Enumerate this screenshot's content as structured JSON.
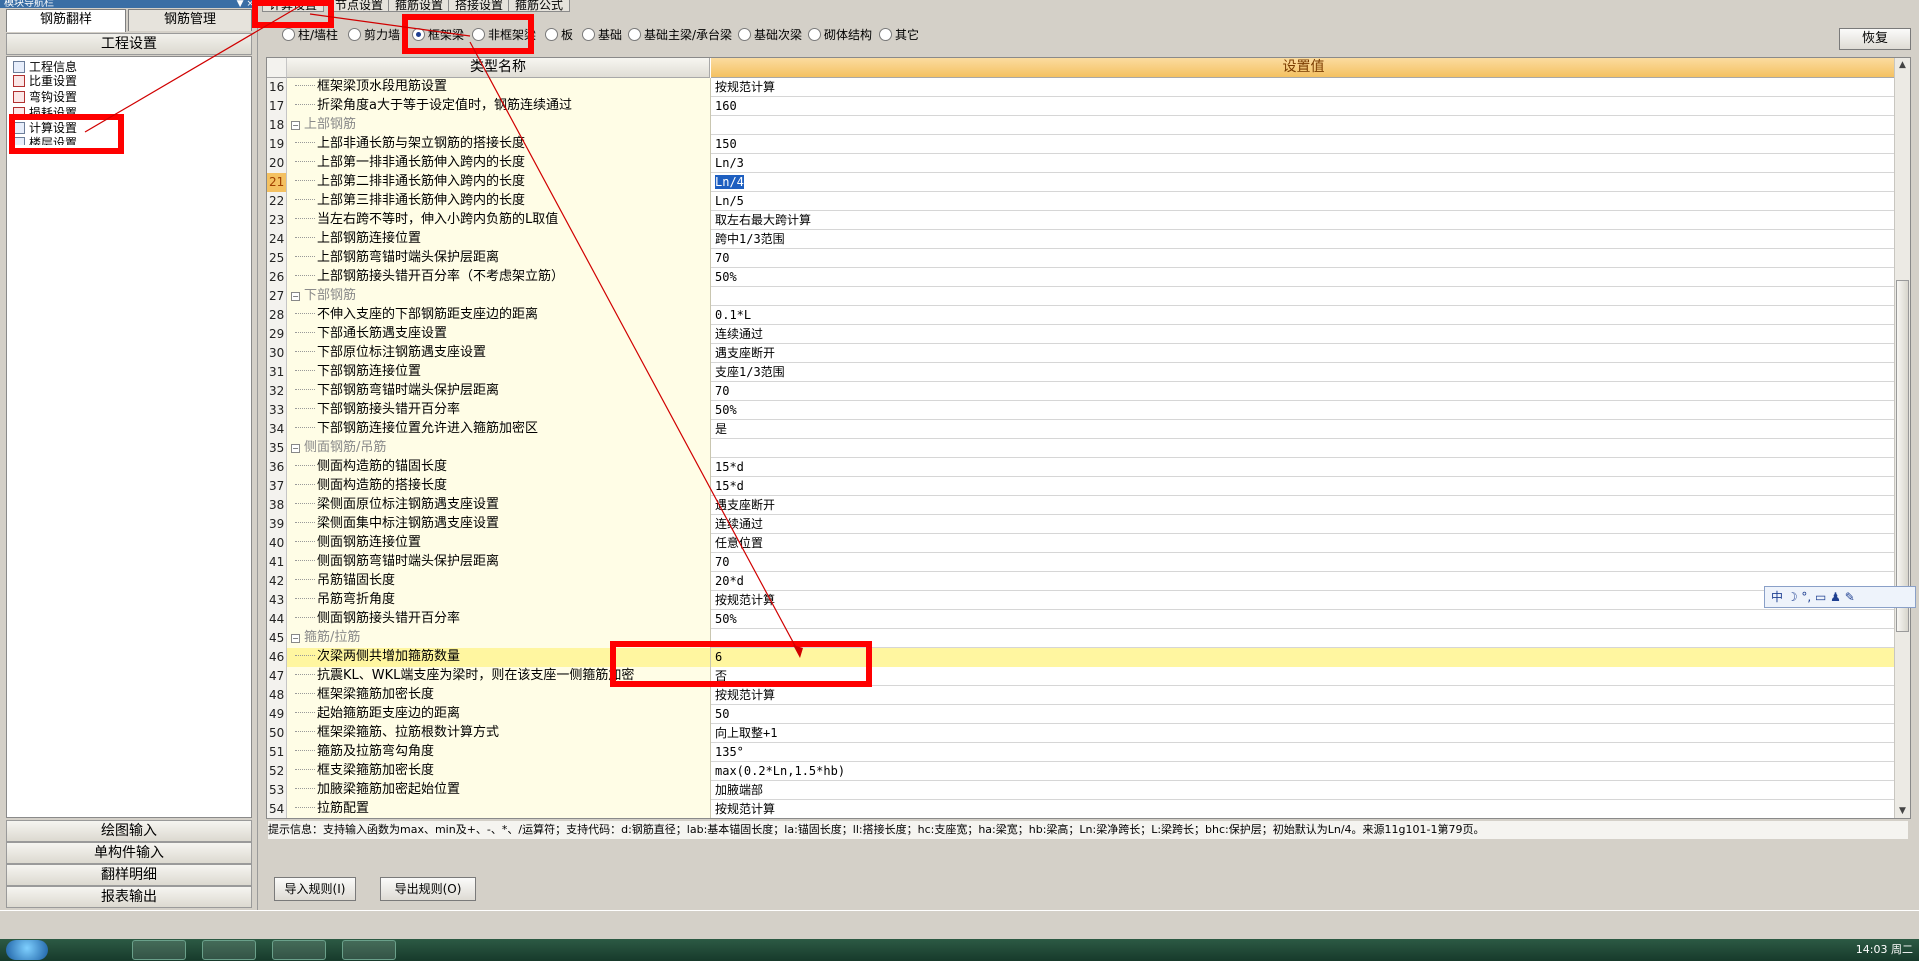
{
  "nav": {
    "caption": "模块导航栏",
    "ctrls": "▼ ×"
  },
  "left_tabs": [
    "钢筋翻样",
    "钢筋管理"
  ],
  "project_header": "工程设置",
  "tree": [
    "工程信息",
    "比重设置",
    "弯钩设置",
    "损耗设置",
    "计算设置",
    "楼层设置"
  ],
  "left_bottom": [
    "绘图输入",
    "单构件输入",
    "翻样明细",
    "报表输出"
  ],
  "top_tabs": [
    "计算设置",
    "节点设置",
    "箍筋设置",
    "搭接设置",
    "箍筋公式"
  ],
  "radios": [
    {
      "label": "柱/墙柱",
      "on": false
    },
    {
      "label": "剪力墙",
      "on": false
    },
    {
      "label": "框架梁",
      "on": true
    },
    {
      "label": "非框架梁",
      "on": false
    },
    {
      "label": "板",
      "on": false
    },
    {
      "label": "基础",
      "on": false
    },
    {
      "label": "基础主梁/承台梁",
      "on": false
    },
    {
      "label": "基础次梁",
      "on": false
    },
    {
      "label": "砌体结构",
      "on": false
    },
    {
      "label": "其它",
      "on": false
    }
  ],
  "restore_label": "恢复",
  "grid": {
    "col_name": "类型名称",
    "col_value": "设置值"
  },
  "rows": [
    {
      "n": "16",
      "name": "框架梁顶水段甩筋设置",
      "val": "按规范计算"
    },
    {
      "n": "17",
      "name": "折梁角度a大于等于设定值时，钢筋连续通过",
      "val": "160"
    },
    {
      "n": "18",
      "name": "上部钢筋",
      "val": "",
      "group": true
    },
    {
      "n": "19",
      "name": "上部非通长筋与架立钢筋的搭接长度",
      "val": "150"
    },
    {
      "n": "20",
      "name": "上部第一排非通长筋伸入跨内的长度",
      "val": "Ln/3"
    },
    {
      "n": "21",
      "name": "上部第二排非通长筋伸入跨内的长度",
      "val": "Ln/4",
      "sel": true
    },
    {
      "n": "22",
      "name": "上部第三排非通长筋伸入跨内的长度",
      "val": "Ln/5"
    },
    {
      "n": "23",
      "name": "当左右跨不等时，伸入小跨内负筋的L取值",
      "val": "取左右最大跨计算"
    },
    {
      "n": "24",
      "name": "上部钢筋连接位置",
      "val": "跨中1/3范围"
    },
    {
      "n": "25",
      "name": "上部钢筋弯锚时端头保护层距离",
      "val": "70"
    },
    {
      "n": "26",
      "name": "上部钢筋接头错开百分率（不考虑架立筋）",
      "val": "50%"
    },
    {
      "n": "27",
      "name": "下部钢筋",
      "val": "",
      "group": true
    },
    {
      "n": "28",
      "name": "不伸入支座的下部钢筋距支座边的距离",
      "val": "0.1*L"
    },
    {
      "n": "29",
      "name": "下部通长筋遇支座设置",
      "val": "连续通过"
    },
    {
      "n": "30",
      "name": "下部原位标注钢筋遇支座设置",
      "val": "遇支座断开"
    },
    {
      "n": "31",
      "name": "下部钢筋连接位置",
      "val": "支座1/3范围"
    },
    {
      "n": "32",
      "name": "下部钢筋弯锚时端头保护层距离",
      "val": "70"
    },
    {
      "n": "33",
      "name": "下部钢筋接头错开百分率",
      "val": "50%"
    },
    {
      "n": "34",
      "name": "下部钢筋连接位置允许进入箍筋加密区",
      "val": "是"
    },
    {
      "n": "35",
      "name": "侧面钢筋/吊筋",
      "val": "",
      "group": true
    },
    {
      "n": "36",
      "name": "侧面构造筋的锚固长度",
      "val": "15*d"
    },
    {
      "n": "37",
      "name": "侧面构造筋的搭接长度",
      "val": "15*d"
    },
    {
      "n": "38",
      "name": "梁侧面原位标注钢筋遇支座设置",
      "val": "遇支座断开"
    },
    {
      "n": "39",
      "name": "梁侧面集中标注钢筋遇支座设置",
      "val": "连续通过"
    },
    {
      "n": "40",
      "name": "侧面钢筋连接位置",
      "val": "任意位置"
    },
    {
      "n": "41",
      "name": "侧面钢筋弯锚时端头保护层距离",
      "val": "70"
    },
    {
      "n": "42",
      "name": "吊筋锚固长度",
      "val": "20*d"
    },
    {
      "n": "43",
      "name": "吊筋弯折角度",
      "val": "按规范计算"
    },
    {
      "n": "44",
      "name": "侧面钢筋接头错开百分率",
      "val": "50%"
    },
    {
      "n": "45",
      "name": "箍筋/拉筋",
      "val": "",
      "group": true
    },
    {
      "n": "46",
      "name": "次梁两侧共增加箍筋数量",
      "val": "6",
      "hl": true
    },
    {
      "n": "47",
      "name": "抗震KL、WKL端支座为梁时，则在该支座一侧箍筋加密",
      "val": "否"
    },
    {
      "n": "48",
      "name": "框架梁箍筋加密长度",
      "val": "按规范计算"
    },
    {
      "n": "49",
      "name": "起始箍筋距支座边的距离",
      "val": "50"
    },
    {
      "n": "50",
      "name": "框架梁箍筋、拉筋根数计算方式",
      "val": "向上取整+1"
    },
    {
      "n": "51",
      "name": "箍筋及拉筋弯勾角度",
      "val": "135°"
    },
    {
      "n": "52",
      "name": "框支梁箍筋加密长度",
      "val": "max(0.2*Ln,1.5*hb)"
    },
    {
      "n": "53",
      "name": "加腋梁箍筋加密起始位置",
      "val": "加腋端部"
    },
    {
      "n": "54",
      "name": "拉筋配置",
      "val": "按规范计算"
    }
  ],
  "hint": "提示信息：支持输入函数为max、min及+、-、*、/运算符；支持代码：d:钢筋直径；lab:基本锚固长度；la:锚固长度；ll:搭接长度；hc:支座宽；ha:梁宽；hb:梁高；Ln:梁净跨长；L:梁跨长；bhc:保护层；初始默认为Ln/4。来源11g101-1第79页。",
  "bottom_buttons": [
    "导入规则(I)",
    "导出规则(O)"
  ],
  "ime": "中 ☽ °, ▭ ♟ ✎",
  "clock": "14:03 周二",
  "colors": {
    "annotation": "#ff0000",
    "header_value": "#f4c161",
    "name_bg": "#fffde6",
    "highlight": "#fff6a0"
  }
}
